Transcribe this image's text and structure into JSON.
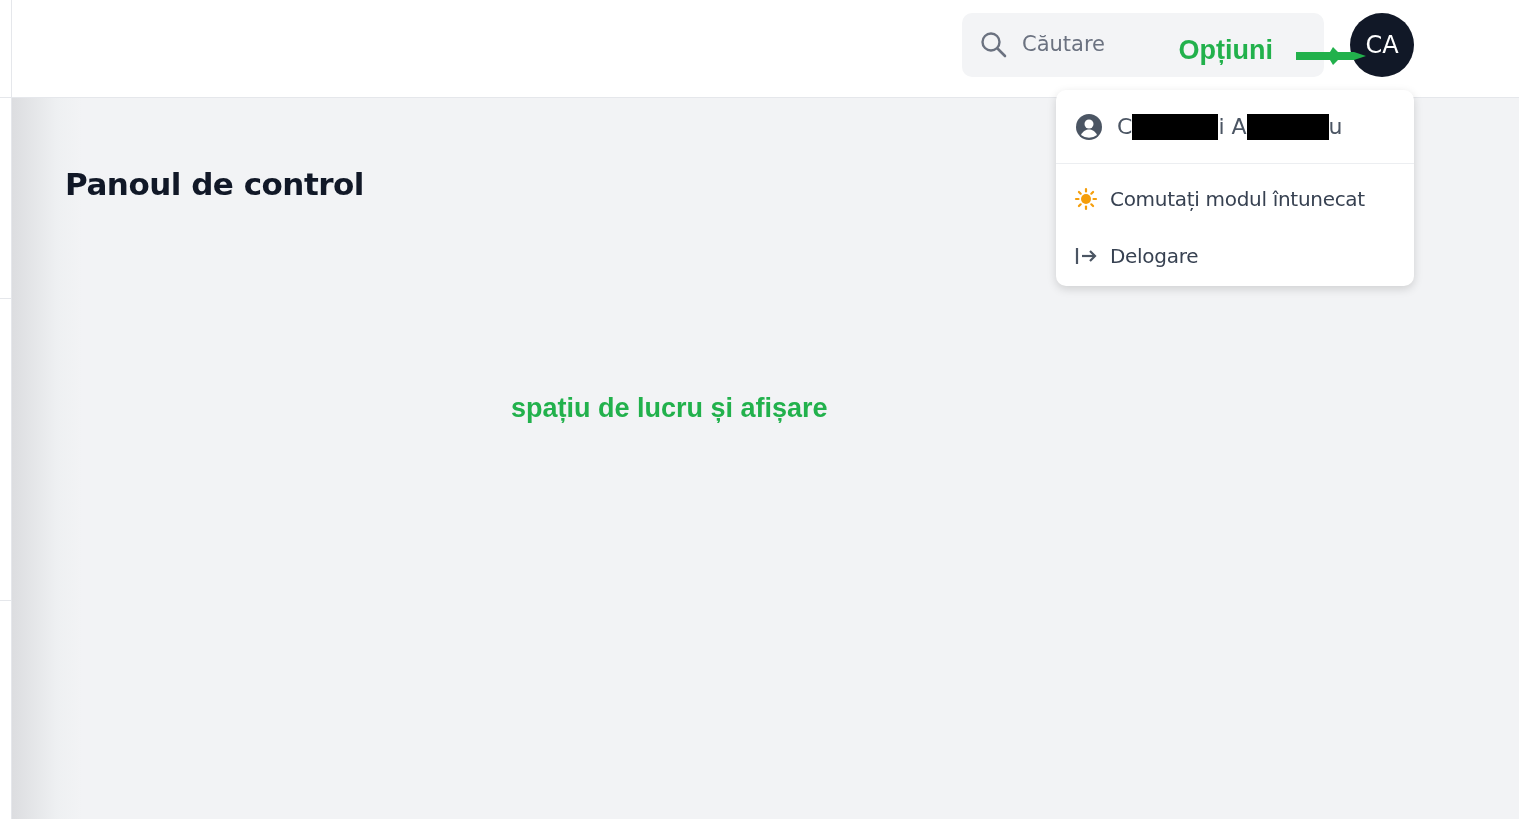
{
  "header": {
    "search": {
      "placeholder": "Căutare"
    },
    "avatar": {
      "initials": "CA"
    }
  },
  "user_menu": {
    "user_name_parts": [
      "C",
      "i A",
      "u"
    ],
    "items": [
      {
        "kind": "theme",
        "label": "Comutați modul întunecat"
      },
      {
        "kind": "logout",
        "label": "Delogare"
      }
    ]
  },
  "page": {
    "title": "Panoul de control"
  },
  "annotations": [
    {
      "kind": "arrow-label",
      "text": "Opțiuni"
    },
    {
      "kind": "area-label",
      "text": "spațiu de lucru și afișare"
    }
  ]
}
